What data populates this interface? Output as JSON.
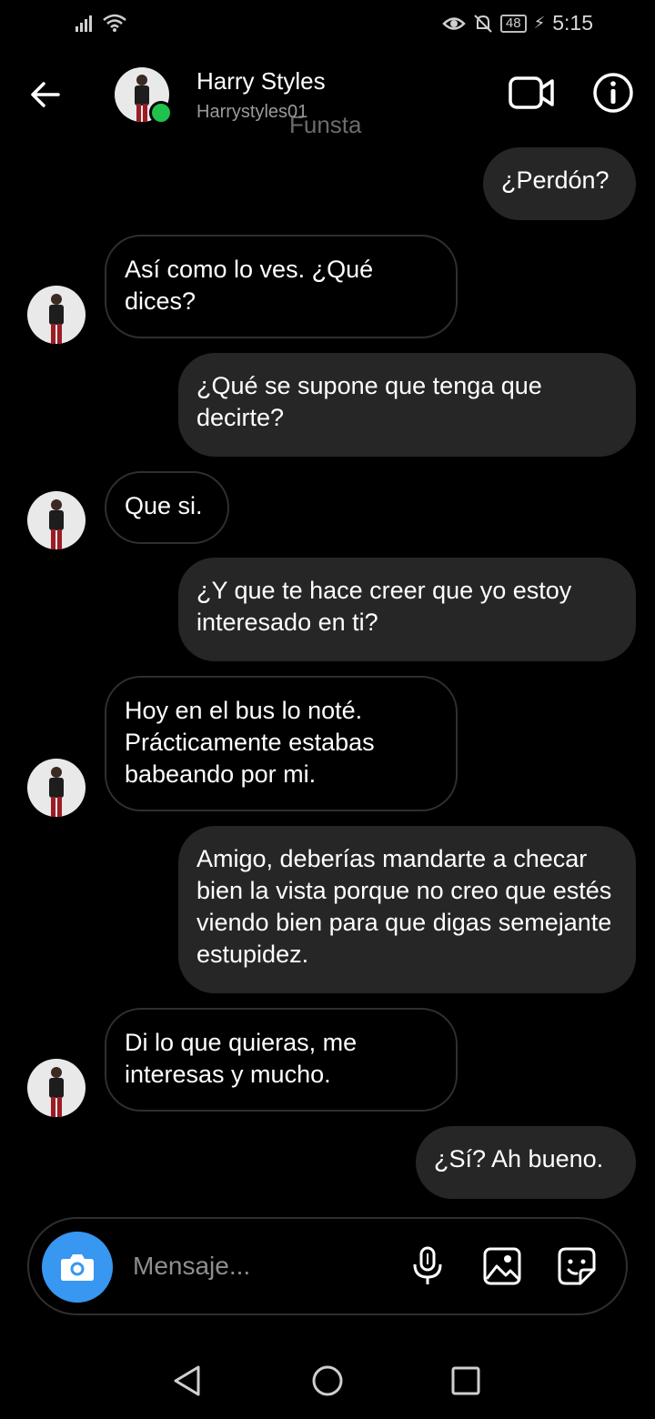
{
  "status_bar": {
    "time": "5:15",
    "battery": "48"
  },
  "header": {
    "name": "Harry Styles",
    "username": "Harrystyles01",
    "watermark": "Funsta"
  },
  "messages": [
    {
      "from": "me",
      "text": "¿Perdón?"
    },
    {
      "from": "them",
      "text": "Así como lo ves. ¿Qué dices?"
    },
    {
      "from": "me",
      "text": "¿Qué se supone que tenga que decirte?"
    },
    {
      "from": "them",
      "text": "Que si."
    },
    {
      "from": "me",
      "text": "¿Y que te hace creer que yo estoy interesado en ti?"
    },
    {
      "from": "them",
      "text": "Hoy en el bus lo noté. Prácticamente estabas babeando por mi."
    },
    {
      "from": "me",
      "text": "Amigo, deberías mandarte a checar bien la vista porque no creo que estés viendo bien para que digas semejante estupidez."
    },
    {
      "from": "them",
      "text": "Di lo que quieras, me interesas y mucho."
    },
    {
      "from": "me",
      "text": "¿Sí? Ah bueno."
    }
  ],
  "composer": {
    "placeholder": "Mensaje..."
  },
  "colors": {
    "background": "#000000",
    "outgoing_bubble": "#262626",
    "incoming_border": "#2f2f2f",
    "camera_button": "#3897f0",
    "online_dot": "#1fc24a"
  },
  "icons": [
    "back-arrow-icon",
    "video-call-icon",
    "info-icon",
    "camera-icon",
    "microphone-icon",
    "gallery-icon",
    "sticker-icon",
    "nav-back-icon",
    "nav-home-icon",
    "nav-recents-icon"
  ]
}
